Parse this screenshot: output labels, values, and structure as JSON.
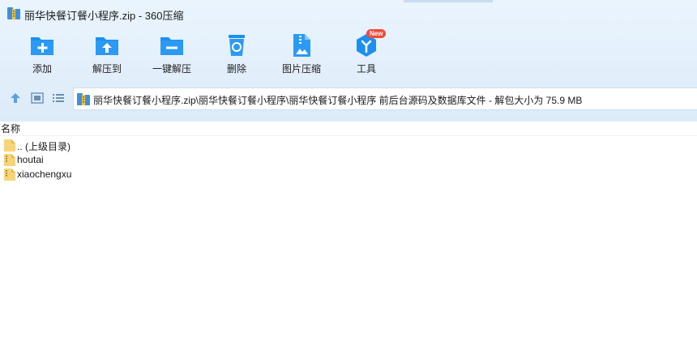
{
  "window": {
    "title": "丽华快餐订餐小程序.zip - 360压缩"
  },
  "toolbar": {
    "items": [
      {
        "label": "添加",
        "icon": "add-folder-icon"
      },
      {
        "label": "解压到",
        "icon": "extract-to-icon"
      },
      {
        "label": "一键解压",
        "icon": "one-click-extract-icon"
      },
      {
        "label": "删除",
        "icon": "recycle-bin-icon"
      },
      {
        "label": "图片压缩",
        "icon": "image-compress-icon"
      },
      {
        "label": "工具",
        "icon": "tools-icon",
        "badge": "New"
      }
    ]
  },
  "address": {
    "path": "丽华快餐订餐小程序.zip\\丽华快餐订餐小程序\\丽华快餐订餐小程序 前后台源码及数据库文件 - 解包大小为 75.9 MB"
  },
  "file_list": {
    "column_name": "名称",
    "rows": [
      {
        "name": ".. (上级目录)",
        "type": "parent"
      },
      {
        "name": "houtai",
        "type": "folder"
      },
      {
        "name": "xiaochengxu",
        "type": "folder"
      }
    ]
  },
  "colors": {
    "accent_blue": "#1d8ff0",
    "toolbar_bg": "#e2effb",
    "badge_red": "#f04a3c",
    "folder_yellow": "#f7d47a"
  }
}
